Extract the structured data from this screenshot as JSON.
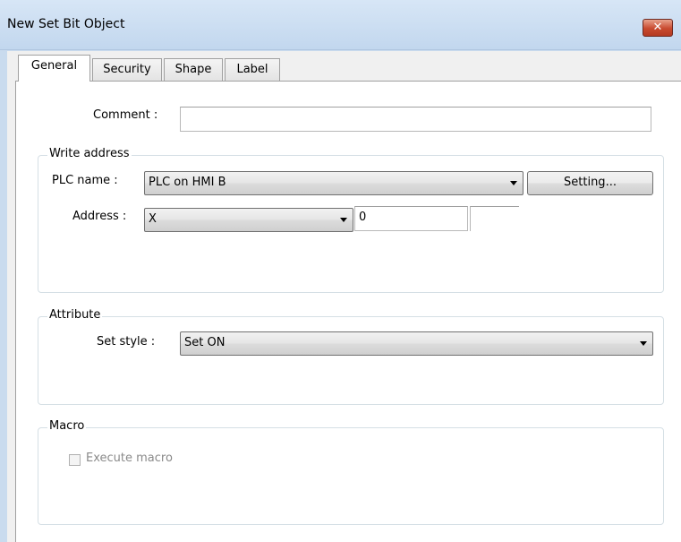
{
  "window": {
    "title": "New  Set Bit Object",
    "close_glyph": "✕"
  },
  "tabs": [
    {
      "label": "General",
      "active": true
    },
    {
      "label": "Security",
      "active": false
    },
    {
      "label": "Shape",
      "active": false
    },
    {
      "label": "Label",
      "active": false
    }
  ],
  "general": {
    "comment_label": "Comment :",
    "comment_value": "",
    "write_address": {
      "title": "Write address",
      "plc_name_label": "PLC name :",
      "plc_name_value": "PLC on HMI B",
      "setting_button": "Setting...",
      "address_label": "Address :",
      "address_type": "X",
      "address_value": "0",
      "address_extra": ""
    },
    "attribute": {
      "title": "Attribute",
      "set_style_label": "Set style :",
      "set_style_value": "Set ON"
    },
    "macro": {
      "title": "Macro",
      "execute_macro_label": "Execute macro",
      "execute_macro_checked": false,
      "execute_macro_enabled": false
    }
  }
}
